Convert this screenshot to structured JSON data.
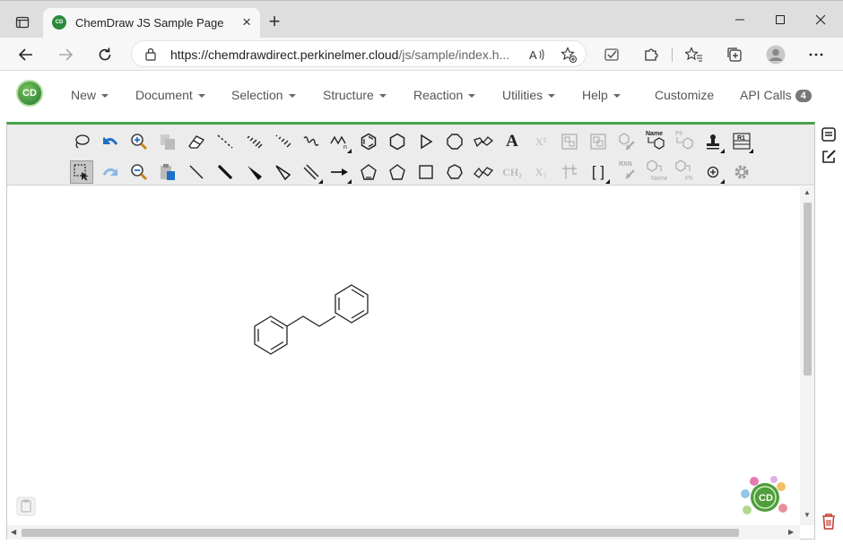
{
  "browser": {
    "tab_title": "ChemDraw JS Sample Page",
    "favicon_text": "CD",
    "url_host": "https://chemdrawdirect.perkinelmer.cloud",
    "url_path": "/js/sample/index.h..."
  },
  "app": {
    "logo_text": "CD",
    "menu": {
      "new": "New",
      "document": "Document",
      "selection": "Selection",
      "structure": "Structure",
      "reaction": "Reaction",
      "utilities": "Utilities",
      "help": "Help",
      "customize": "Customize",
      "api_calls": "API Calls",
      "api_calls_count": "4"
    }
  },
  "toolbar": {
    "text_tool": "A",
    "superscript": "X²",
    "subscript": "X₂",
    "ch2_label": "CH₂",
    "name_label": "Name",
    "ph_label": "Ph",
    "rxn_label": "RXN",
    "r1_label": "R1",
    "brackets": "[ ]"
  },
  "canvas": {
    "molecule": "bibenzyl (1,2-diphenylethane)",
    "watermark_text": "CD"
  },
  "colors": {
    "accent_green": "#4aa24a",
    "tool_blue": "#1e6fc8",
    "trash_red": "#c0392b"
  }
}
